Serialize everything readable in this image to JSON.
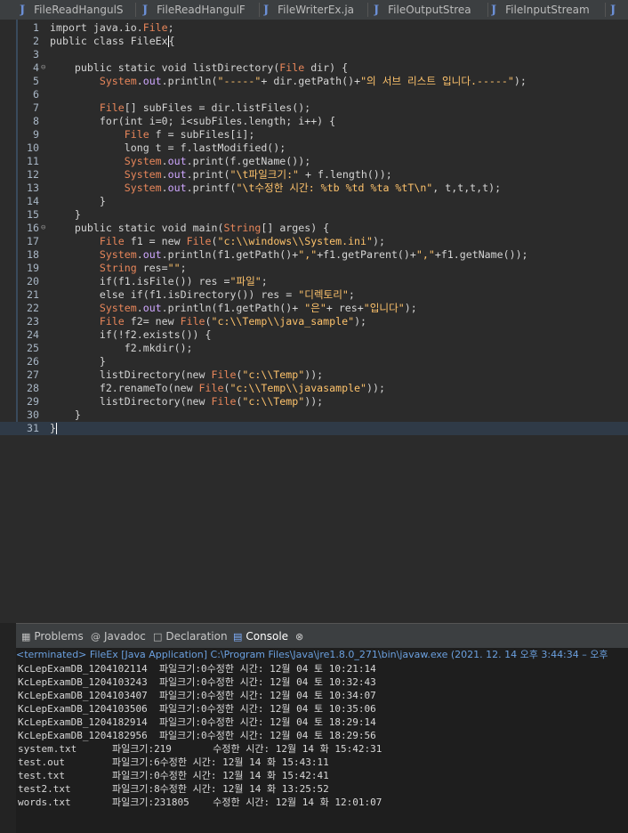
{
  "tabs": [
    {
      "label": "FileReadHangulS"
    },
    {
      "label": "FileReadHangulF"
    },
    {
      "label": "FileWriterEx.ja"
    },
    {
      "label": "FileOutputStrea"
    },
    {
      "label": "FileInputStream"
    },
    {
      "label": ""
    }
  ],
  "editor": {
    "lines": [
      {
        "n": "1",
        "code": "import java.io.File;"
      },
      {
        "n": "2",
        "code": "public class FileEx{"
      },
      {
        "n": "3",
        "code": ""
      },
      {
        "n": "4",
        "code": "    public static void listDirectory(File dir) {"
      },
      {
        "n": "5",
        "code": "        System.out.println(\"-----\"+ dir.getPath()+\"의 서브 리스트 입니다.-----\");"
      },
      {
        "n": "6",
        "code": ""
      },
      {
        "n": "7",
        "code": "        File[] subFiles = dir.listFiles();"
      },
      {
        "n": "8",
        "code": "        for(int i=0; i<subFiles.length; i++) {"
      },
      {
        "n": "9",
        "code": "            File f = subFiles[i];"
      },
      {
        "n": "10",
        "code": "            long t = f.lastModified();"
      },
      {
        "n": "11",
        "code": "            System.out.print(f.getName());"
      },
      {
        "n": "12",
        "code": "            System.out.print(\"\\t파일크기:\" + f.length());"
      },
      {
        "n": "13",
        "code": "            System.out.printf(\"\\t수정한 시간: %tb %td %ta %tT\\n\", t,t,t,t);"
      },
      {
        "n": "14",
        "code": "        }"
      },
      {
        "n": "15",
        "code": "    }"
      },
      {
        "n": "16",
        "code": "    public static void main(String[] arges) {"
      },
      {
        "n": "17",
        "code": "        File f1 = new File(\"c:\\\\windows\\\\System.ini\");"
      },
      {
        "n": "18",
        "code": "        System.out.println(f1.getPath()+\",\"+f1.getParent()+\",\"+f1.getName());"
      },
      {
        "n": "19",
        "code": "        String res=\"\";"
      },
      {
        "n": "20",
        "code": "        if(f1.isFile()) res =\"파일\";"
      },
      {
        "n": "21",
        "code": "        else if(f1.isDirectory()) res = \"디렉토리\";"
      },
      {
        "n": "22",
        "code": "        System.out.println(f1.getPath()+ \"은\"+ res+\"입니다\");"
      },
      {
        "n": "23",
        "code": "        File f2= new File(\"c:\\\\Temp\\\\java_sample\");"
      },
      {
        "n": "24",
        "code": "        if(!f2.exists()) {"
      },
      {
        "n": "25",
        "code": "            f2.mkdir();"
      },
      {
        "n": "26",
        "code": "        }"
      },
      {
        "n": "27",
        "code": "        listDirectory(new File(\"c:\\\\Temp\"));"
      },
      {
        "n": "28",
        "code": "        f2.renameTo(new File(\"c:\\\\Temp\\\\javasample\"));"
      },
      {
        "n": "29",
        "code": "        listDirectory(new File(\"c:\\\\Temp\"));"
      },
      {
        "n": "30",
        "code": "    }"
      },
      {
        "n": "31",
        "code": "}"
      }
    ]
  },
  "views": {
    "tabs": [
      {
        "label": "Problems",
        "icon": "problems-icon"
      },
      {
        "label": "Javadoc",
        "icon": "javadoc-icon"
      },
      {
        "label": "Declaration",
        "icon": "declaration-icon"
      },
      {
        "label": "Console",
        "icon": "console-icon"
      }
    ],
    "active": "Console"
  },
  "console": {
    "status": "<terminated> FileEx [Java Application] C:\\Program Files\\Java\\jre1.8.0_271\\bin\\javaw.exe  (2021. 12. 14 오후 3:44:34 – 오후",
    "rows": [
      "KcLepExamDB_1204102114  파일크기:0수정한 시간: 12월 04 토 10:21:14",
      "KcLepExamDB_1204103243  파일크기:0수정한 시간: 12월 04 토 10:32:43",
      "KcLepExamDB_1204103407  파일크기:0수정한 시간: 12월 04 토 10:34:07",
      "KcLepExamDB_1204103506  파일크기:0수정한 시간: 12월 04 토 10:35:06",
      "KcLepExamDB_1204182914  파일크기:0수정한 시간: 12월 04 토 18:29:14",
      "KcLepExamDB_1204182956  파일크기:0수정한 시간: 12월 04 토 18:29:56",
      "system.txt      파일크기:219       수정한 시간: 12월 14 화 15:42:31",
      "test.out        파일크기:6수정한 시간: 12월 14 화 15:43:11",
      "test.txt        파일크기:0수정한 시간: 12월 14 화 15:42:41",
      "test2.txt       파일크기:8수정한 시간: 12월 14 화 13:25:52",
      "words.txt       파일크기:231805    수정한 시간: 12월 14 화 12:01:07"
    ]
  }
}
